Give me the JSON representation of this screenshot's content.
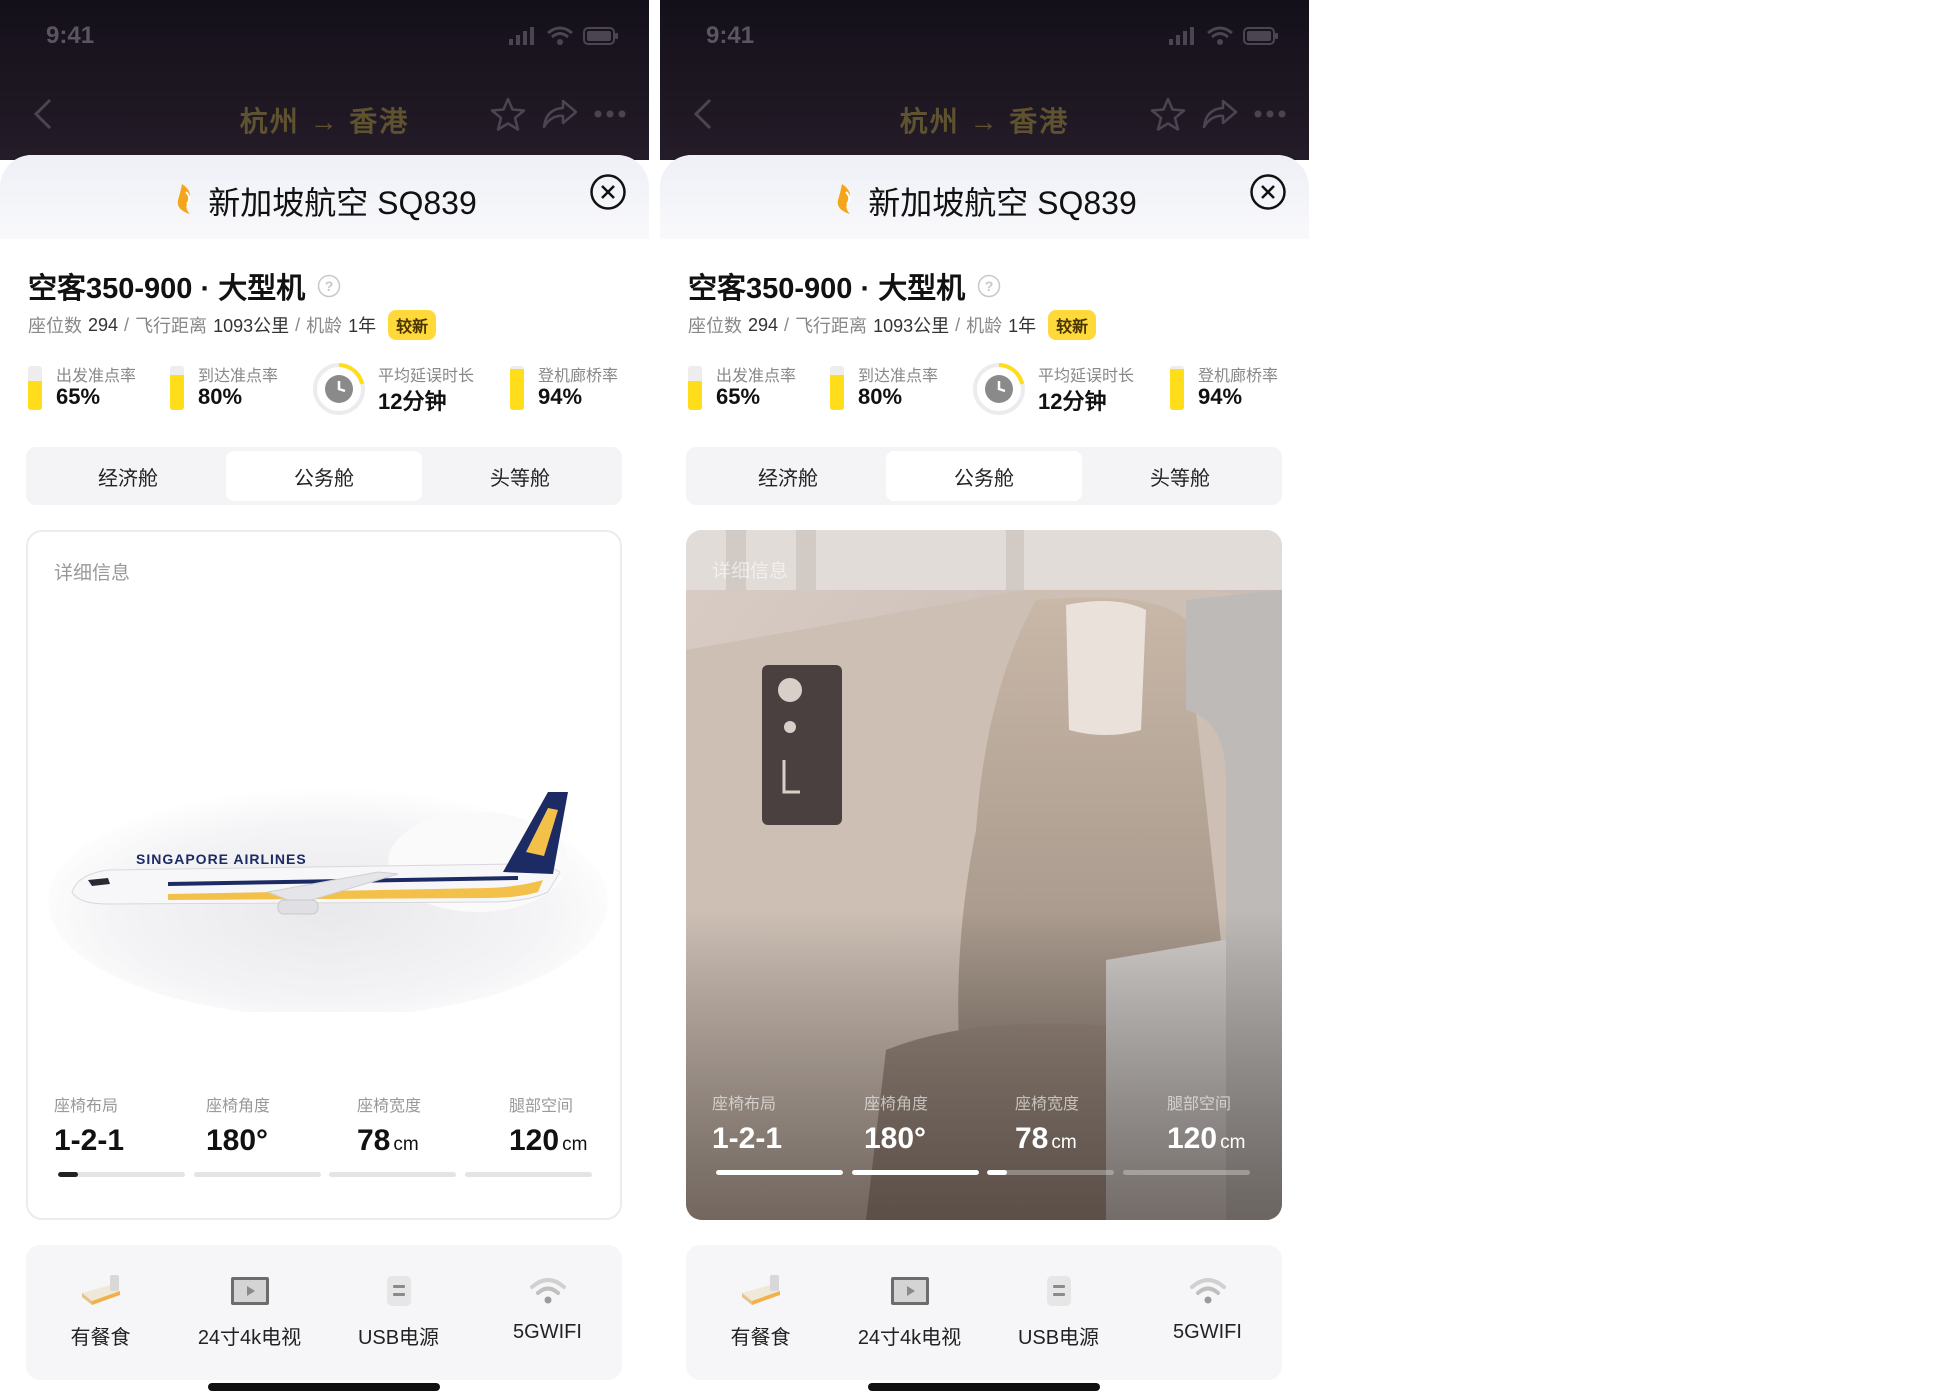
{
  "screens": [
    {
      "status": {
        "time": "9:41"
      },
      "nav": {
        "title": "杭州 → 香港"
      },
      "sheet": {
        "title": "新加坡航空 SQ839"
      },
      "aircraft": {
        "name": "空客350-900 · 大型机",
        "seats_label": "座位数",
        "seats": "294",
        "distance_label": "飞行距离",
        "distance": "1093公里",
        "age_label": "机龄",
        "age": "1年",
        "badge": "较新",
        "sep": "/"
      },
      "stats": [
        {
          "label": "出发准点率",
          "value": "65%",
          "level": 0.65
        },
        {
          "label": "到达准点率",
          "value": "80%",
          "level": 0.8
        },
        {
          "label": "平均延误时长",
          "value": "12分钟"
        },
        {
          "label": "登机廊桥率",
          "value": "94%",
          "level": 0.94
        }
      ],
      "tabs": [
        "经济舱",
        "公务舱",
        "头等舱"
      ],
      "active_tab": 1,
      "detail": {
        "label": "详细信息",
        "specs": [
          {
            "label": "座椅布局",
            "value": "1-2-1",
            "unit": ""
          },
          {
            "label": "座椅角度",
            "value": "180°",
            "unit": ""
          },
          {
            "label": "座椅宽度",
            "value": "78",
            "unit": "cm"
          },
          {
            "label": "腿部空间",
            "value": "120",
            "unit": "cm"
          }
        ],
        "progress": [
          0.16,
          0,
          0,
          0
        ]
      },
      "amenities": [
        {
          "icon": "meal-icon",
          "label": "有餐食"
        },
        {
          "icon": "tv-icon",
          "label": "24寸4k电视"
        },
        {
          "icon": "usb-icon",
          "label": "USB电源"
        },
        {
          "icon": "wifi-icon",
          "label": "5GWIFI"
        }
      ]
    },
    {
      "status": {
        "time": "9:41"
      },
      "nav": {
        "title": "杭州 → 香港"
      },
      "sheet": {
        "title": "新加坡航空 SQ839"
      },
      "aircraft": {
        "name": "空客350-900 · 大型机",
        "seats_label": "座位数",
        "seats": "294",
        "distance_label": "飞行距离",
        "distance": "1093公里",
        "age_label": "机龄",
        "age": "1年",
        "badge": "较新",
        "sep": "/"
      },
      "stats": [
        {
          "label": "出发准点率",
          "value": "65%",
          "level": 0.65
        },
        {
          "label": "到达准点率",
          "value": "80%",
          "level": 0.8
        },
        {
          "label": "平均延误时长",
          "value": "12分钟"
        },
        {
          "label": "登机廊桥率",
          "value": "94%",
          "level": 0.94
        }
      ],
      "tabs": [
        "经济舱",
        "公务舱",
        "头等舱"
      ],
      "active_tab": 1,
      "detail": {
        "label": "详细信息",
        "specs": [
          {
            "label": "座椅布局",
            "value": "1-2-1",
            "unit": ""
          },
          {
            "label": "座椅角度",
            "value": "180°",
            "unit": ""
          },
          {
            "label": "座椅宽度",
            "value": "78",
            "unit": "cm"
          },
          {
            "label": "腿部空间",
            "value": "120",
            "unit": "cm"
          }
        ],
        "progress": [
          1,
          1,
          0.16,
          0
        ]
      },
      "amenities": [
        {
          "icon": "meal-icon",
          "label": "有餐食"
        },
        {
          "icon": "tv-icon",
          "label": "24寸4k电视"
        },
        {
          "icon": "usb-icon",
          "label": "USB电源"
        },
        {
          "icon": "wifi-icon",
          "label": "5GWIFI"
        }
      ]
    }
  ],
  "colors": {
    "accent_yellow": "#ffdd1a",
    "badge_yellow": "#ffd93a",
    "header_dark": "#1d1722"
  }
}
